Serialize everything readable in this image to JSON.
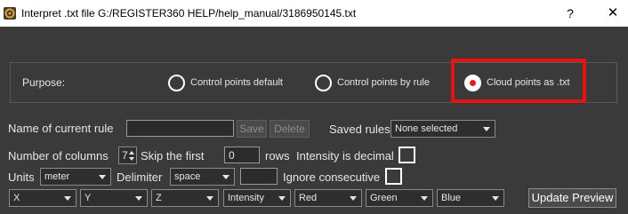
{
  "window": {
    "title": "Interpret .txt file G:/REGISTER360 HELP/help_manual/3186950145.txt",
    "help_glyph": "?",
    "close_glyph": "✕",
    "icon": "app-logo-icon"
  },
  "purpose": {
    "label": "Purpose:",
    "options": [
      {
        "label": "Control points default",
        "checked": false
      },
      {
        "label": "Control points by rule",
        "checked": false
      },
      {
        "label": "Cloud points as .txt",
        "checked": true
      }
    ],
    "highlight_color": "#e41414"
  },
  "rule": {
    "name_label": "Name of current rule",
    "name_value": "",
    "save_label": "Save",
    "delete_label": "Delete",
    "saved_rules_label": "Saved rules",
    "saved_rules_value": "None selected"
  },
  "parse": {
    "columns_label": "Number of columns",
    "columns_value": "7",
    "skip_label": "Skip the first",
    "skip_value": "0",
    "rows_label": "rows",
    "intensity_decimal_label": "Intensity is decimal",
    "intensity_decimal_checked": false
  },
  "format": {
    "units_label": "Units",
    "units_value": "meter",
    "delimiter_label": "Delimiter",
    "delimiter_value": "space",
    "delimiter_custom": "",
    "ignore_label": "Ignore consecutive",
    "ignore_checked": false
  },
  "columns": [
    "X",
    "Y",
    "Z",
    "Intensity",
    "Red",
    "Green",
    "Blue"
  ],
  "update_label": "Update Preview"
}
